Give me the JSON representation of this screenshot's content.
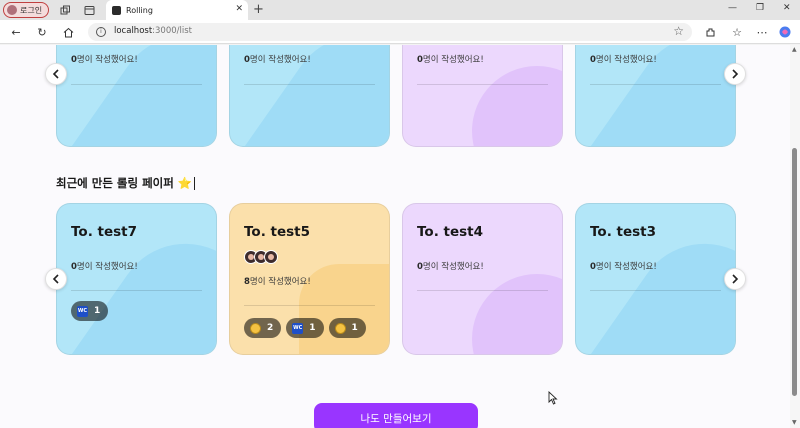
{
  "browser": {
    "profile_label": "로그인",
    "tab_title": "Rolling",
    "url_host": "localhost",
    "url_path": ":3000/list"
  },
  "top_row_cards": [
    {
      "count": "0",
      "count_suffix": "명이 작성했어요!",
      "theme": "blue"
    },
    {
      "count": "0",
      "count_suffix": "명이 작성했어요!",
      "theme": "blue"
    },
    {
      "count": "0",
      "count_suffix": "명이 작성했어요!",
      "theme": "purple"
    },
    {
      "count": "0",
      "count_suffix": "명이 작성했어요!",
      "theme": "blue"
    }
  ],
  "recent_section": {
    "title": "최근에 만든 롤링 페이퍼 ⭐",
    "cards": [
      {
        "title": "To. test7",
        "count": "0",
        "count_suffix": "명이 작성했어요!",
        "theme": "blue",
        "reactions": [
          {
            "icon": "wc-icon",
            "count": "1"
          }
        ]
      },
      {
        "title": "To. test5",
        "count": "8",
        "count_suffix": "명이 작성했어요!",
        "theme": "orange",
        "reactions": [
          {
            "icon": "grin-icon",
            "count": "2"
          },
          {
            "icon": "wc-icon",
            "count": "1"
          },
          {
            "icon": "grin-icon",
            "count": "1"
          }
        ]
      },
      {
        "title": "To. test4",
        "count": "0",
        "count_suffix": "명이 작성했어요!",
        "theme": "purple",
        "reactions": []
      },
      {
        "title": "To. test3",
        "count": "0",
        "count_suffix": "명이 작성했어요!",
        "theme": "blue",
        "reactions": []
      }
    ]
  },
  "cta": {
    "label": "나도 만들어보기"
  },
  "icons": {
    "prev": "chevron-left-icon",
    "next": "chevron-right-icon",
    "reaction_wc_text": "WC"
  },
  "colors": {
    "accent": "#9935ff",
    "card_blue": "#b2e6f8",
    "card_purple": "#ecd8fd",
    "card_orange": "#fbe0ab"
  }
}
